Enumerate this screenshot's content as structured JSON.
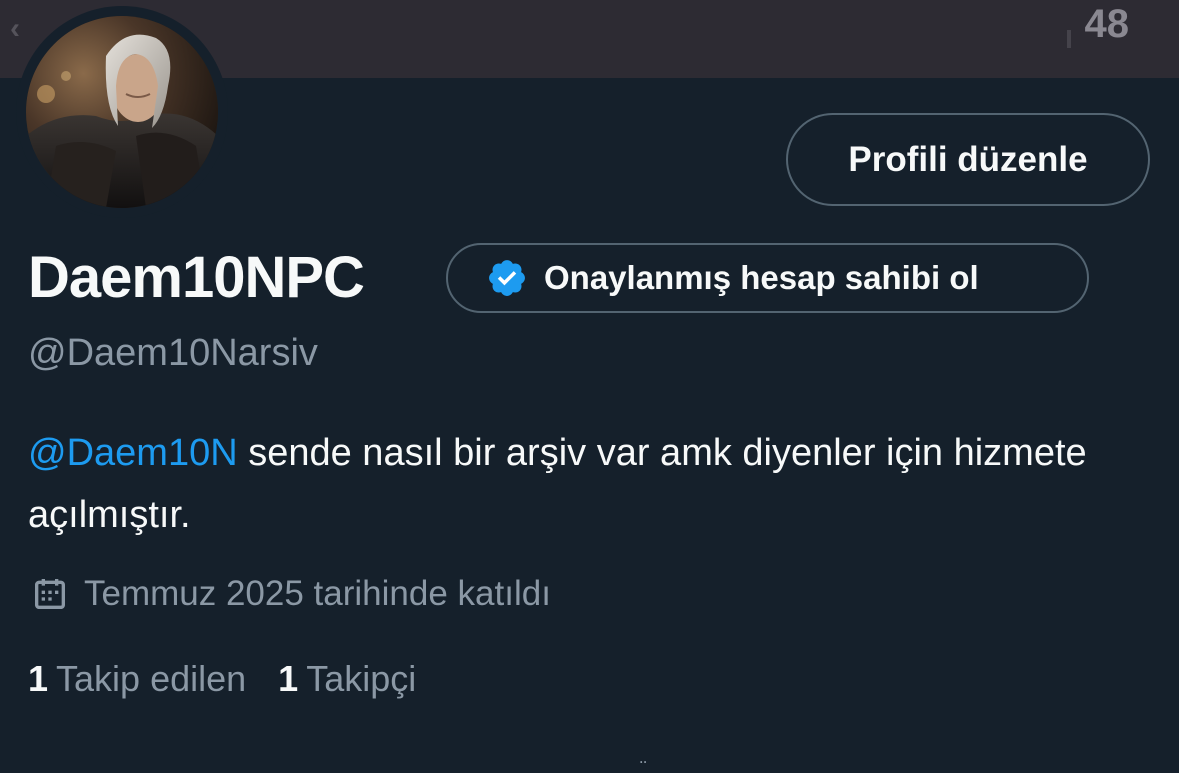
{
  "header": {
    "back_glyph": "‹",
    "count": "48"
  },
  "profile": {
    "display_name": "Daem10NPC",
    "handle": "@Daem10Narsiv",
    "edit_button_label": "Profili düzenle",
    "verify_button_label": "Onaylanmış hesap sahibi ol",
    "bio": {
      "mention": "@Daem10N",
      "text": " sende nasıl bir arşiv var amk diyenler için hizmete açılmıştır."
    },
    "joined": "Temmuz 2025 tarihinde katıldı",
    "following": {
      "count": "1",
      "label": "Takip edilen"
    },
    "followers": {
      "count": "1",
      "label": "Takipçi"
    }
  },
  "icons": {
    "verify": "verified-badge-icon",
    "calendar": "calendar-icon"
  },
  "colors": {
    "background": "#15202b",
    "banner": "#2d2b33",
    "accent": "#1d9bf0",
    "text_primary": "#f7f9f9",
    "text_secondary": "#8b98a5",
    "border": "#536471"
  }
}
